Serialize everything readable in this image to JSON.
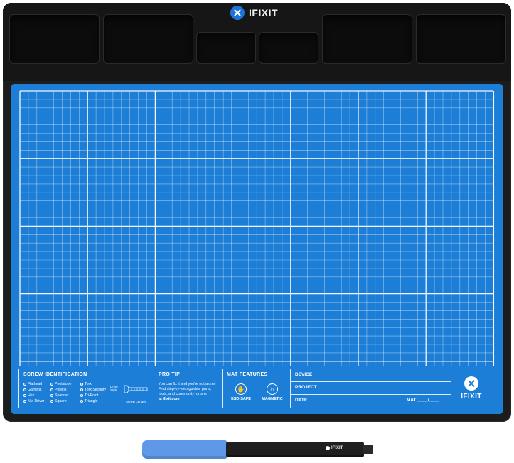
{
  "brand": {
    "name": "IFIXIT"
  },
  "colors": {
    "mat_blue": "#1c7ed6",
    "tray": "#1c1c1c",
    "cap_blue": "#5f98e8"
  },
  "info_panel": {
    "screw_identification": {
      "title": "SCREW IDENTIFICATION",
      "items": [
        "Flathead",
        "Pentalobe",
        "Torx",
        "Gamebit",
        "Phillips",
        "Torx Security",
        "Hex",
        "Spanner",
        "Tri-Point",
        "Nut Driver",
        "Square",
        "Triangle"
      ],
      "drive_style": "Drive Style",
      "screw_length": "Screw Length"
    },
    "pro_tip": {
      "title": "PRO TIP",
      "lines": [
        "You can fix it and you're not alone!",
        "Find step-by-step guides, parts,",
        "tools, and community forums",
        "at ifixit.com"
      ]
    },
    "mat_features": {
      "title": "MAT FEATURES",
      "esd": "ESD-SAFE",
      "magnetic": "MAGNETIC"
    },
    "fields": {
      "device": "DEVICE",
      "project": "PROJECT",
      "date": "DATE",
      "mat": "MAT ____/____"
    },
    "logo_text": "IFIXIT"
  },
  "marker": {
    "brand": "IFIXIT"
  }
}
